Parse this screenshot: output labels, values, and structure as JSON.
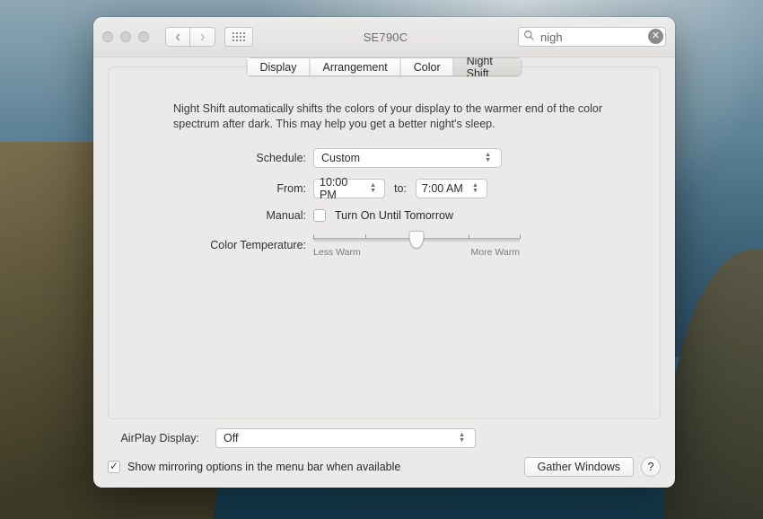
{
  "window": {
    "title": "SE790C"
  },
  "search": {
    "value": "nigh"
  },
  "tabs": {
    "items": [
      "Display",
      "Arrangement",
      "Color",
      "Night Shift"
    ],
    "active_index": 3
  },
  "description": "Night Shift automatically shifts the colors of your display to the warmer end of the color spectrum after dark. This may help you get a better night's sleep.",
  "labels": {
    "schedule": "Schedule:",
    "from": "From:",
    "to": "to:",
    "manual": "Manual:",
    "color_temperature": "Color Temperature:",
    "airplay_display": "AirPlay Display:"
  },
  "schedule": {
    "value": "Custom"
  },
  "from_time": "10:00 PM",
  "to_time": "7:00 AM",
  "manual": {
    "checked": false,
    "label": "Turn On Until Tomorrow"
  },
  "slider": {
    "min_label": "Less Warm",
    "max_label": "More Warm",
    "value": 0.5
  },
  "airplay": {
    "value": "Off"
  },
  "mirroring": {
    "checked": true,
    "label": "Show mirroring options in the menu bar when available"
  },
  "buttons": {
    "gather": "Gather Windows",
    "help": "?"
  }
}
